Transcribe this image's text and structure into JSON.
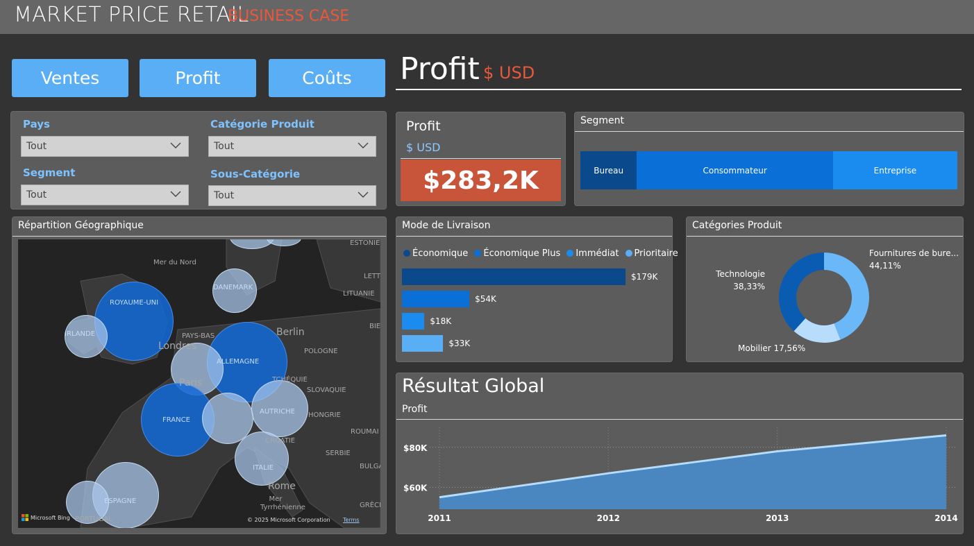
{
  "header": {
    "title": "MARKET PRICE RETAIL",
    "subtitle": "BUSINESS CASE"
  },
  "nav": {
    "buttons": [
      "Ventes",
      "Profit",
      "Coûts"
    ]
  },
  "page_heading": {
    "title": "Profit",
    "unit": "$ USD"
  },
  "filters": {
    "pays": {
      "label": "Pays",
      "value": "Tout"
    },
    "categorie": {
      "label": "Catégorie Produit",
      "value": "Tout"
    },
    "segment": {
      "label": "Segment",
      "value": "Tout"
    },
    "sous_categorie": {
      "label": "Sous-Catégorie",
      "value": "Tout"
    }
  },
  "kpi": {
    "title": "Profit",
    "unit": "$ USD",
    "value": "$283,2K",
    "color": "#c8543a"
  },
  "segment_panel": {
    "title": "Segment",
    "segments": [
      {
        "label": "Bureau",
        "share": 0.15,
        "color": "#0a4a8c"
      },
      {
        "label": "Consommateur",
        "share": 0.52,
        "color": "#0a6fd6"
      },
      {
        "label": "Entreprise",
        "share": 0.33,
        "color": "#1a8cf0"
      }
    ]
  },
  "map_panel": {
    "title": "Répartition Géographique",
    "attribution": "© 2025 Microsoft Corporation",
    "terms": "Terms",
    "bing": "Microsoft Bing",
    "places": [
      "ESTONIE",
      "Mer du Nord",
      "LETT",
      "LITUANIE",
      "DANEMARK",
      "ROYAUME-UNI",
      "IRLANDE",
      "PAYS-BAS",
      "Londres",
      "Berlin",
      "POLOGNE",
      "BIE",
      "ALLEMAGNE",
      "TCHÉQUIE",
      "SLOVAQUIE",
      "Paris",
      "FRANCE",
      "AUTRICHE",
      "HONGRIE",
      "CROATIE",
      "ROUMAI",
      "SERBIE",
      "ITALIE",
      "BULGA",
      "Rome",
      "ESPAGNE",
      "Mer Tyrrhénienne",
      "GRÈCE",
      "PORTUGAL"
    ]
  },
  "livraison_panel": {
    "title": "Mode de Livraison",
    "legend": [
      {
        "label": "Économique",
        "color": "#0a4a8c"
      },
      {
        "label": "Économique Plus",
        "color": "#0a6fd6"
      },
      {
        "label": "Immédiat",
        "color": "#1a8cf0"
      },
      {
        "label": "Prioritaire",
        "color": "#5aaef5"
      }
    ]
  },
  "categories_panel": {
    "title": "Catégories Produit"
  },
  "resultat_panel": {
    "title": "Résultat Global",
    "subtitle": "Profit"
  },
  "chart_data": [
    {
      "type": "bar",
      "orientation": "horizontal",
      "categories": [
        "Économique",
        "Économique Plus",
        "Immédiat",
        "Prioritaire"
      ],
      "values": [
        179,
        54,
        18,
        33
      ],
      "labels": [
        "$179K",
        "$54K",
        "$18K",
        "$33K"
      ],
      "colors": [
        "#0a4a8c",
        "#0a6fd6",
        "#1a8cf0",
        "#5aaef5"
      ]
    },
    {
      "type": "pie",
      "variant": "donut",
      "slices": [
        {
          "label": "Fournitures de bure...",
          "value": 44.11,
          "pct": "44,11%",
          "color": "#6ab8f7"
        },
        {
          "label": "Mobilier",
          "value": 17.56,
          "pct": "17,56%",
          "color": "#b8dcfb"
        },
        {
          "label": "Technologie",
          "value": 38.33,
          "pct": "38,33%",
          "color": "#0a5cb3"
        }
      ]
    },
    {
      "type": "area",
      "x": [
        "2011",
        "2012",
        "2013",
        "2014"
      ],
      "values": [
        55,
        67,
        78,
        86
      ],
      "ylim": [
        49,
        90
      ],
      "ytick_values": [
        60,
        80
      ],
      "yticks": [
        "$60K",
        "$80K"
      ],
      "fill": "#4a86c0",
      "line": "#b5dcfb"
    }
  ]
}
